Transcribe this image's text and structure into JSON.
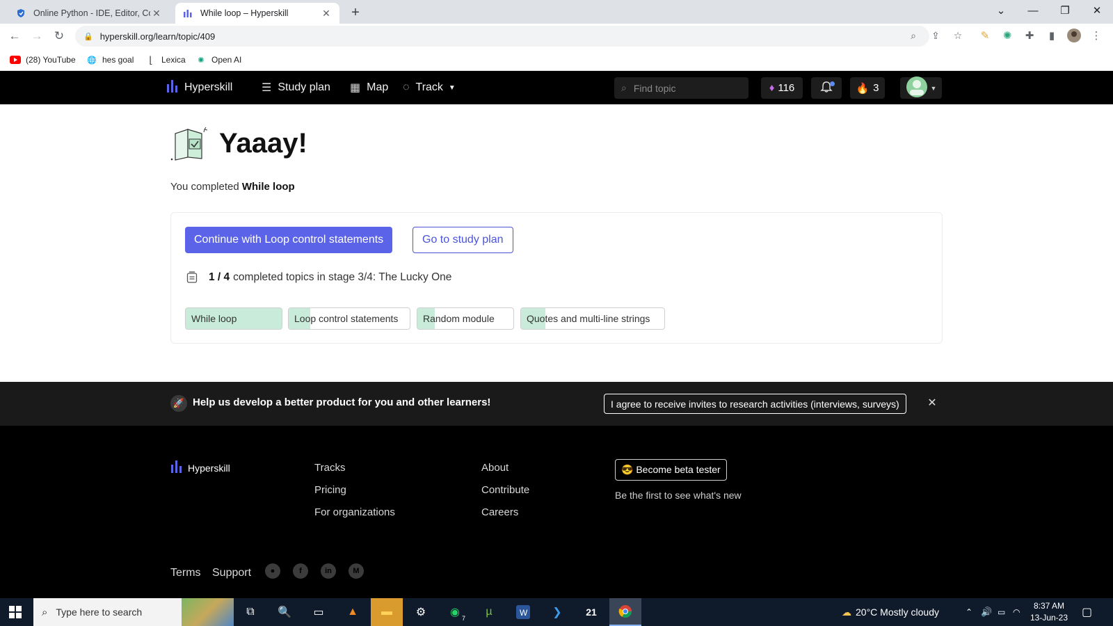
{
  "browser": {
    "tabs": [
      {
        "title": "Online Python - IDE, Editor, Com",
        "icon": "python-ide-icon"
      },
      {
        "title": "While loop – Hyperskill",
        "icon": "hyperskill-icon"
      }
    ],
    "url": "hyperskill.org/learn/topic/409",
    "bookmarks": [
      {
        "label": "(28) YouTube",
        "icon": "youtube-icon"
      },
      {
        "label": "hes goal",
        "icon": "globe-icon"
      },
      {
        "label": "Lexica",
        "icon": "lexica-icon"
      },
      {
        "label": "Open AI",
        "icon": "openai-icon"
      }
    ]
  },
  "nav": {
    "brand": "Hyperskill",
    "study_plan": "Study plan",
    "map": "Map",
    "track": "Track",
    "search_placeholder": "Find topic",
    "gems": "116",
    "streak": "3"
  },
  "main": {
    "title": "Yaaay!",
    "completed_prefix": "You completed",
    "completed_topic": "While loop",
    "continue_label": "Continue with Loop control statements",
    "study_plan_label": "Go to study plan",
    "progress_count": "1 / 4",
    "progress_text": "completed topics in stage 3/4: The Lucky One",
    "topics": [
      {
        "label": "While loop",
        "progress": 1.0
      },
      {
        "label": "Loop control statements",
        "progress": 0.18
      },
      {
        "label": "Random module",
        "progress": 0.18
      },
      {
        "label": "Quotes and multi-line strings",
        "progress": 0.17
      }
    ]
  },
  "banner": {
    "message": "Help us develop a better product for you and other learners!",
    "agree_label": "I agree to receive invites to research activities (interviews, surveys)"
  },
  "footer": {
    "brand": "Hyperskill",
    "col1": [
      "Tracks",
      "Pricing",
      "For organizations"
    ],
    "col2": [
      "About",
      "Contribute",
      "Careers"
    ],
    "beta_label": "😎 Become beta tester",
    "beta_sub": "Be the first to see what's new",
    "terms": "Terms",
    "support": "Support"
  },
  "taskbar": {
    "search_placeholder": "Type here to search",
    "weather": "20°C  Mostly cloudy",
    "time": "8:37 AM",
    "date": "13-Jun-23",
    "whatsapp_badge": "7",
    "app_21": "21"
  },
  "colors": {
    "accent": "#5b63e8",
    "chip_fill": "#c8ecd9",
    "nav_bg": "#000000"
  }
}
